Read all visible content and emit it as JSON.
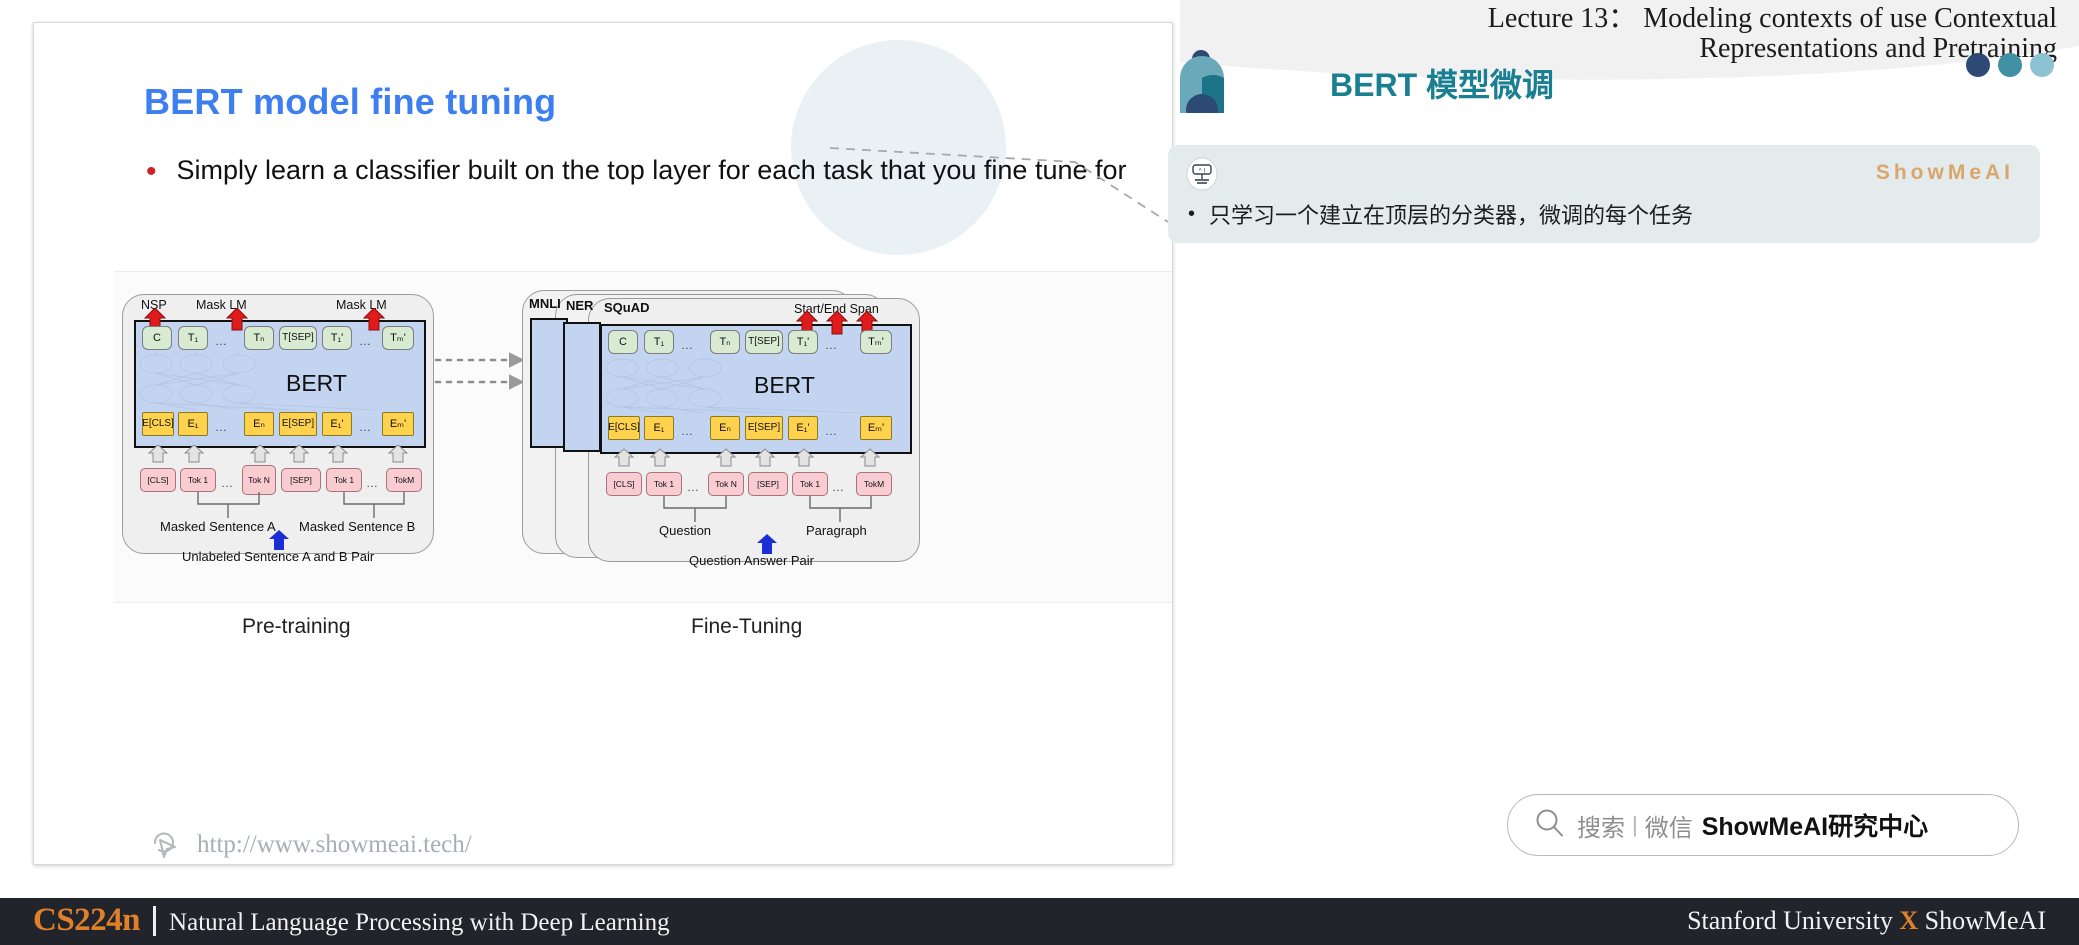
{
  "header": {
    "lecture_title_line1": "Lecture 13： Modeling contexts of use Contextual",
    "lecture_title_line2": "Representations and Pretraining",
    "zh_title": "BERT 模型微调",
    "brand_teal": "#1a7f91"
  },
  "note": {
    "brand": "ShowMeAI",
    "bullet_dot": "•",
    "bullet_text": "只学习一个建立在顶层的分类器，微调的每个任务",
    "avatar_icon": "robot-face-icon",
    "card_bg": "#e3ebec",
    "brand_color": "#d9a66c"
  },
  "slide": {
    "title": "BERT model fine tuning",
    "title_color": "#3d7ef0",
    "bullet_dot": "•",
    "bullet_text": "Simply learn a classifier built on the top layer for each task that you fine tune for",
    "watermark_url": "http://www.showmeai.tech/",
    "watermark_icon": "cursor-pointer-icon"
  },
  "figure": {
    "pretraining_caption": "Pre-training",
    "finetuning_caption": "Fine-Tuning",
    "bert_label": "BERT",
    "left": {
      "head_labels": [
        "NSP",
        "Mask LM",
        "Mask LM"
      ],
      "t_cells": [
        "C",
        "T₁",
        "…",
        "Tₙ",
        "T[SEP]",
        "T₁'",
        "…",
        "Tₘ'"
      ],
      "e_cells": [
        "E[CLS]",
        "E₁",
        "…",
        "Eₙ",
        "E[SEP]",
        "E₁'",
        "…",
        "Eₘ'"
      ],
      "tok_cells": [
        "[CLS]",
        "Tok 1",
        "…",
        "Tok N",
        "[SEP]",
        "Tok 1",
        "…",
        "TokM"
      ],
      "group_labels": [
        "Masked Sentence A",
        "Masked Sentence B"
      ],
      "input_label": "Unlabeled Sentence A and B Pair"
    },
    "right": {
      "tab_labels": [
        "MNLI",
        "NER",
        "SQuAD"
      ],
      "head_label": "Start/End Span",
      "t_cells": [
        "C",
        "T₁",
        "…",
        "Tₙ",
        "T[SEP]",
        "T₁'",
        "…",
        "Tₘ'"
      ],
      "e_cells": [
        "E[CLS]",
        "E₁",
        "…",
        "Eₙ",
        "E[SEP]",
        "E₁'",
        "…",
        "Eₘ'"
      ],
      "tok_cells": [
        "[CLS]",
        "Tok 1",
        "…",
        "Tok N",
        "[SEP]",
        "Tok 1",
        "…",
        "TokM"
      ],
      "group_labels": [
        "Question",
        "Paragraph"
      ],
      "input_label": "Question Answer Pair"
    }
  },
  "search": {
    "icon": "magnifier-icon",
    "placeholder": "搜索",
    "separator": "|",
    "channel": "微信",
    "brand": "ShowMeAI研究中心"
  },
  "footer": {
    "course_code": "CS224n",
    "course_name": "Natural Language Processing with Deep Learning",
    "right_pre": "Stanford University ",
    "right_x": "X",
    "right_post": " ShowMeAI",
    "accent": "#e0802a",
    "bg": "#22242c"
  }
}
